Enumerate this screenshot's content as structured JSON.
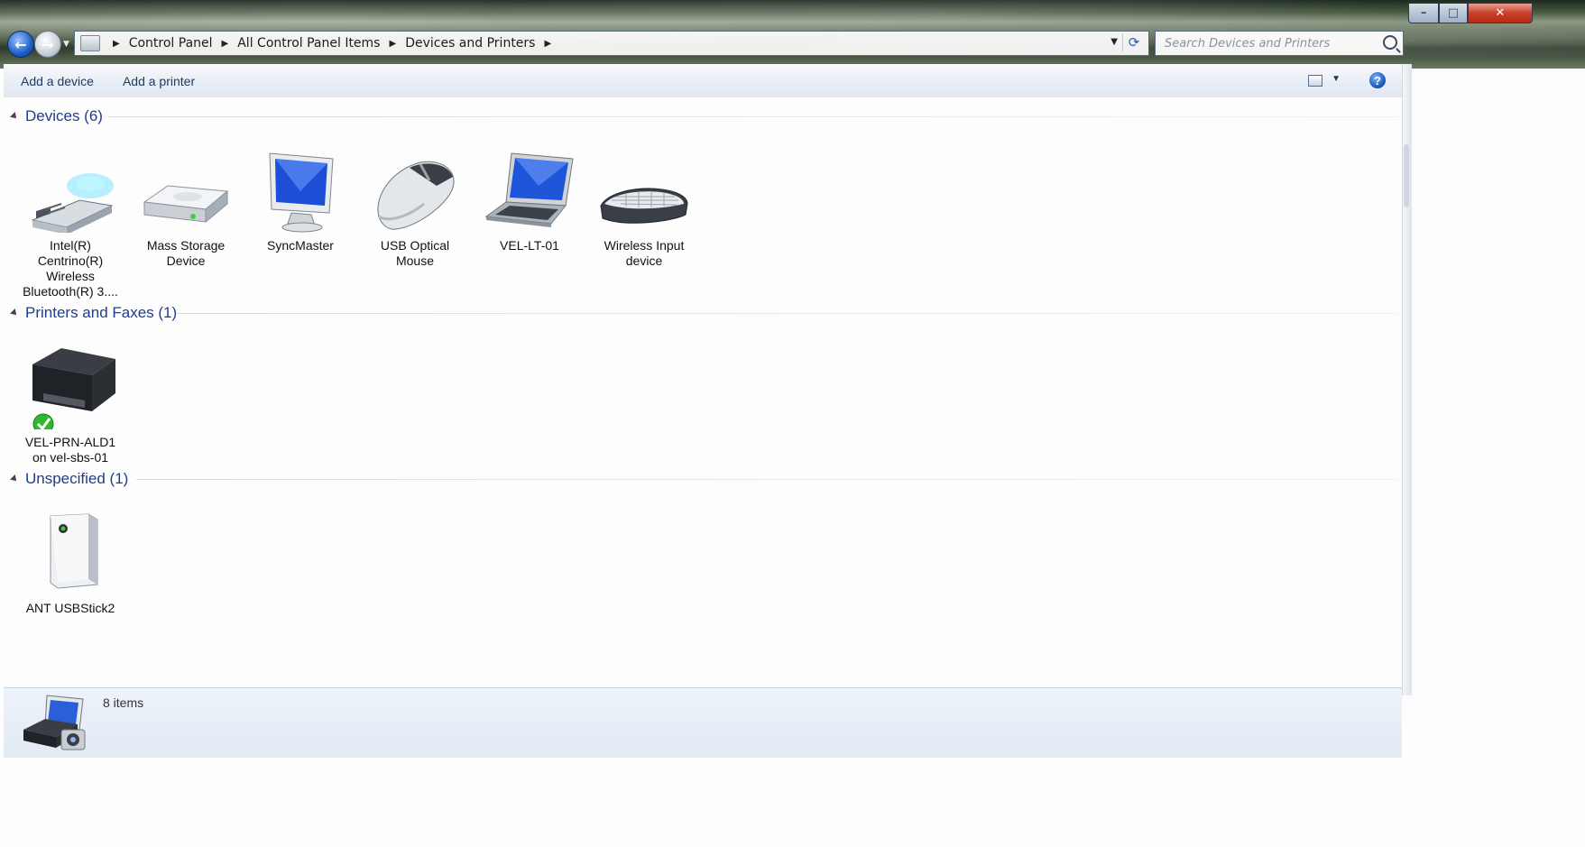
{
  "window": {
    "controls": {
      "minimize": "–",
      "maximize": "□",
      "close": "✕"
    }
  },
  "nav": {
    "back_icon": "back-arrow-icon",
    "forward_icon": "forward-arrow-icon",
    "back_glyph": "←",
    "forward_glyph": "→"
  },
  "address": {
    "crumbs": [
      "Control Panel",
      "All Control Panel Items",
      "Devices and Printers"
    ],
    "separator": "▶",
    "dropdown_glyph": "▼",
    "refresh_glyph": "⟳"
  },
  "search": {
    "placeholder": "Search Devices and Printers"
  },
  "toolbar": {
    "add_device": "Add a device",
    "add_printer": "Add a printer",
    "view_dropdown_glyph": "▼",
    "help_glyph": "?"
  },
  "groups": {
    "devices": {
      "title": "Devices (6)",
      "items": [
        {
          "name": "Intel(R) Centrino(R) Wireless Bluetooth(R) 3....",
          "icon": "bluetooth-usb-adapter-icon"
        },
        {
          "name": "Mass Storage Device",
          "icon": "hard-drive-icon"
        },
        {
          "name": "SyncMaster",
          "icon": "monitor-icon"
        },
        {
          "name": "USB Optical Mouse",
          "icon": "mouse-icon"
        },
        {
          "name": "VEL-LT-01",
          "icon": "laptop-icon"
        },
        {
          "name": "Wireless Input device",
          "icon": "keyboard-icon"
        }
      ]
    },
    "printers": {
      "title": "Printers and Faxes (1)",
      "items": [
        {
          "name": "VEL-PRN-ALD1 on vel-sbs-01",
          "icon": "printer-icon",
          "status": "default-printer-check-icon"
        }
      ]
    },
    "unspecified": {
      "title": "Unspecified (1)",
      "items": [
        {
          "name": "ANT USBStick2",
          "icon": "generic-device-icon"
        }
      ]
    }
  },
  "status": {
    "count": "8 items",
    "icon": "devices-and-printers-icon"
  }
}
